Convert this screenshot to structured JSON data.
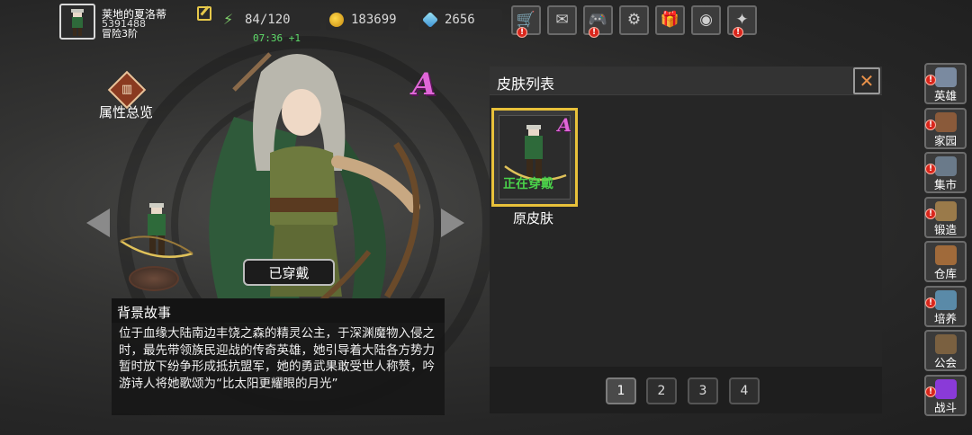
{
  "player": {
    "name": "莱地的夏洛蒂",
    "id": "5391488",
    "rank": "冒险3阶"
  },
  "resources": {
    "energy": "84/120",
    "energy_timer": "07:36 +1",
    "gold": "183699",
    "gems": "2656"
  },
  "top_buttons": [
    {
      "name": "shop",
      "icon": "shopping-cart-icon",
      "glyph": "🛒",
      "badge": "!"
    },
    {
      "name": "mail",
      "icon": "envelope-icon",
      "glyph": "✉",
      "badge": ""
    },
    {
      "name": "gamepad",
      "icon": "gamepad-icon",
      "glyph": "🎮",
      "badge": "!"
    },
    {
      "name": "settings",
      "icon": "gear-icon",
      "glyph": "⚙",
      "badge": ""
    },
    {
      "name": "gift",
      "icon": "gift-icon",
      "glyph": "🎁",
      "badge": ""
    },
    {
      "name": "lottery",
      "icon": "color-wheel-icon",
      "glyph": "◉",
      "badge": ""
    },
    {
      "name": "wand",
      "icon": "magic-wand-icon",
      "glyph": "✦",
      "badge": "!"
    }
  ],
  "hero": {
    "attr_label": "属性总览",
    "rank": "A",
    "equipped_label": "已穿戴"
  },
  "story": {
    "title": "背景故事",
    "body": "位于血缘大陆南边丰饶之森的精灵公主，于深渊魔物入侵之时，最先带领族民迎战的传奇英雄，她引导着大陆各方势力暂时放下纷争形成抵抗盟军，她的勇武果敢受世人称赞，吟游诗人将她歌颂为“比太阳更耀眼的月光”"
  },
  "skin_panel": {
    "title": "皮肤列表",
    "skins": [
      {
        "name": "原皮肤",
        "rank": "A",
        "status": "正在穿戴"
      }
    ],
    "pages": [
      "1",
      "2",
      "3",
      "4"
    ],
    "active_page": "1"
  },
  "sidebar": [
    {
      "label": "英雄",
      "icon": "hero-helmet-icon",
      "color": "#7a8aa0",
      "badge": "!"
    },
    {
      "label": "家园",
      "icon": "castle-icon",
      "color": "#8a5a3a",
      "badge": "!"
    },
    {
      "label": "集市",
      "icon": "market-stall-icon",
      "color": "#6a7a8a",
      "badge": "!"
    },
    {
      "label": "锻造",
      "icon": "anvil-icon",
      "color": "#9a7a4a",
      "badge": "!"
    },
    {
      "label": "仓库",
      "icon": "chest-icon",
      "color": "#a06a3a",
      "badge": ""
    },
    {
      "label": "培养",
      "icon": "potion-icon",
      "color": "#5a8aa8",
      "badge": "!"
    },
    {
      "label": "公会",
      "icon": "guild-shield-icon",
      "color": "#7a6040",
      "badge": ""
    },
    {
      "label": "战斗",
      "icon": "portal-icon",
      "color": "#8a3ad8",
      "badge": "!"
    }
  ]
}
